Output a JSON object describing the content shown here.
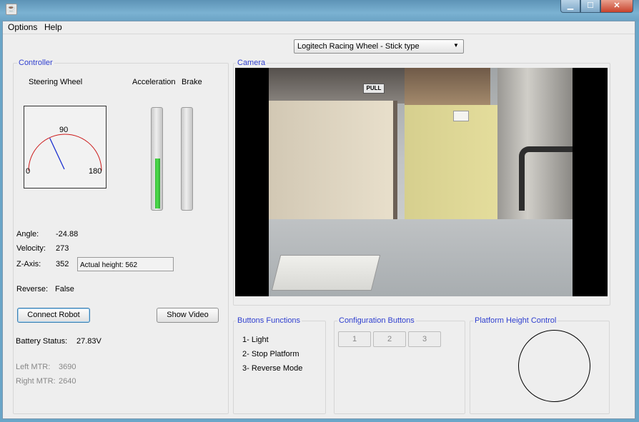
{
  "menu": {
    "options": "Options",
    "help": "Help"
  },
  "device_select": {
    "selected": "Logitech Racing Wheel - Stick type"
  },
  "controller": {
    "title": "Controller",
    "steering_label": "Steering Wheel",
    "acceleration_label": "Acceleration",
    "brake_label": "Brake",
    "dial": {
      "min_label": "0",
      "mid_label": "90",
      "max_label": "180",
      "needle_angle_deg": 65
    },
    "acceleration_level": 0.5,
    "brake_level": 0.0,
    "angle_label": "Angle:",
    "angle_value": "-24.88",
    "velocity_label": "Velocity:",
    "velocity_value": "273",
    "zaxis_label": "Z-Axis:",
    "zaxis_value": "352",
    "actual_height": "Actual height: 562",
    "reverse_label": "Reverse:",
    "reverse_value": "False",
    "connect_button": "Connect Robot",
    "show_video_button": "Show Video",
    "battery_label": "Battery Status:",
    "battery_value": "27.83V",
    "left_mtr_label": "Left MTR:",
    "left_mtr_value": "3690",
    "right_mtr_label": "Right MTR:",
    "right_mtr_value": "2640"
  },
  "camera": {
    "title": "Camera",
    "sign_text": "PULL"
  },
  "buttons_functions": {
    "title": "Buttons Functions",
    "items": [
      "1- Light",
      "2- Stop Platform",
      "3- Reverse Mode"
    ]
  },
  "configuration": {
    "title": "Configuration Buttons",
    "buttons": [
      "1",
      "2",
      "3"
    ]
  },
  "platform": {
    "title": "Platform Height Control"
  },
  "colors": {
    "group_title": "#2f3fcf",
    "gauge_fill": "#44d044",
    "dial_arc": "#cc1a1a",
    "needle": "#1a2fd0"
  },
  "window_controls": {
    "minimize_icon": "minimize-icon",
    "maximize_icon": "maximize-icon",
    "close_icon": "close-icon"
  }
}
